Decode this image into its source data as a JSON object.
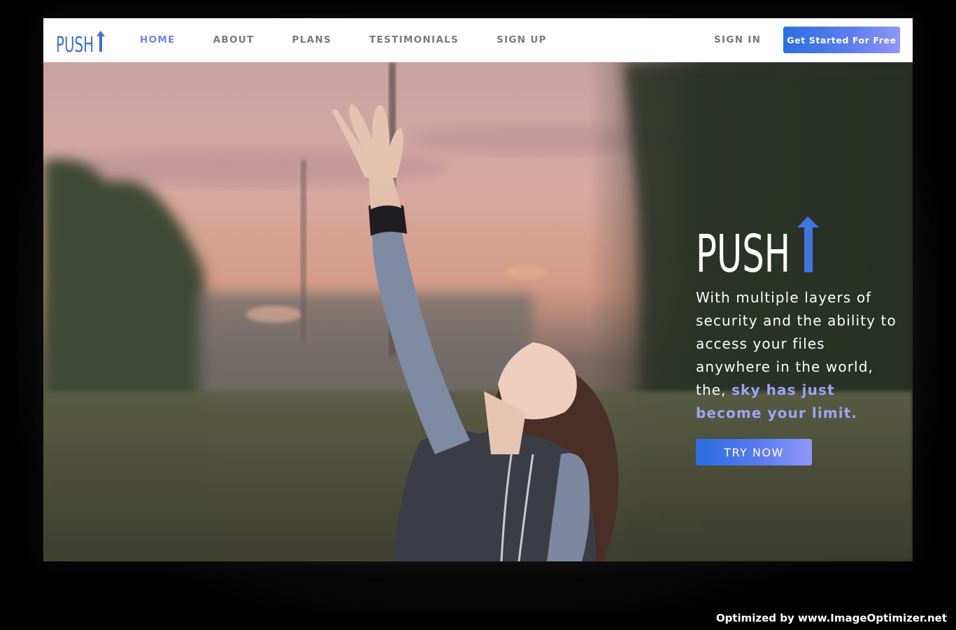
{
  "brand": {
    "name": "PUSH"
  },
  "nav": {
    "links": [
      {
        "label": "HOME",
        "active": true
      },
      {
        "label": "ABOUT"
      },
      {
        "label": "PLANS"
      },
      {
        "label": "TESTIMONIALS"
      },
      {
        "label": "SIGN UP"
      }
    ],
    "sign_in": "SIGN IN",
    "cta": "Get Started For Free"
  },
  "hero": {
    "logo_text": "PUSH",
    "tagline_plain": "With multiple layers of security and the ability to access your files anywhere in the world, the, ",
    "tagline_highlight": "sky has just become your limit.",
    "button": "TRY NOW"
  },
  "watermark": "Optimized by www.ImageOptimizer.net",
  "colors": {
    "accent": "#6f86e6",
    "button_start": "#2b6fe2",
    "button_end": "#8f96f7",
    "highlight_text": "#9aa6f5"
  },
  "icons": [
    "push-logo-arrow-icon"
  ]
}
